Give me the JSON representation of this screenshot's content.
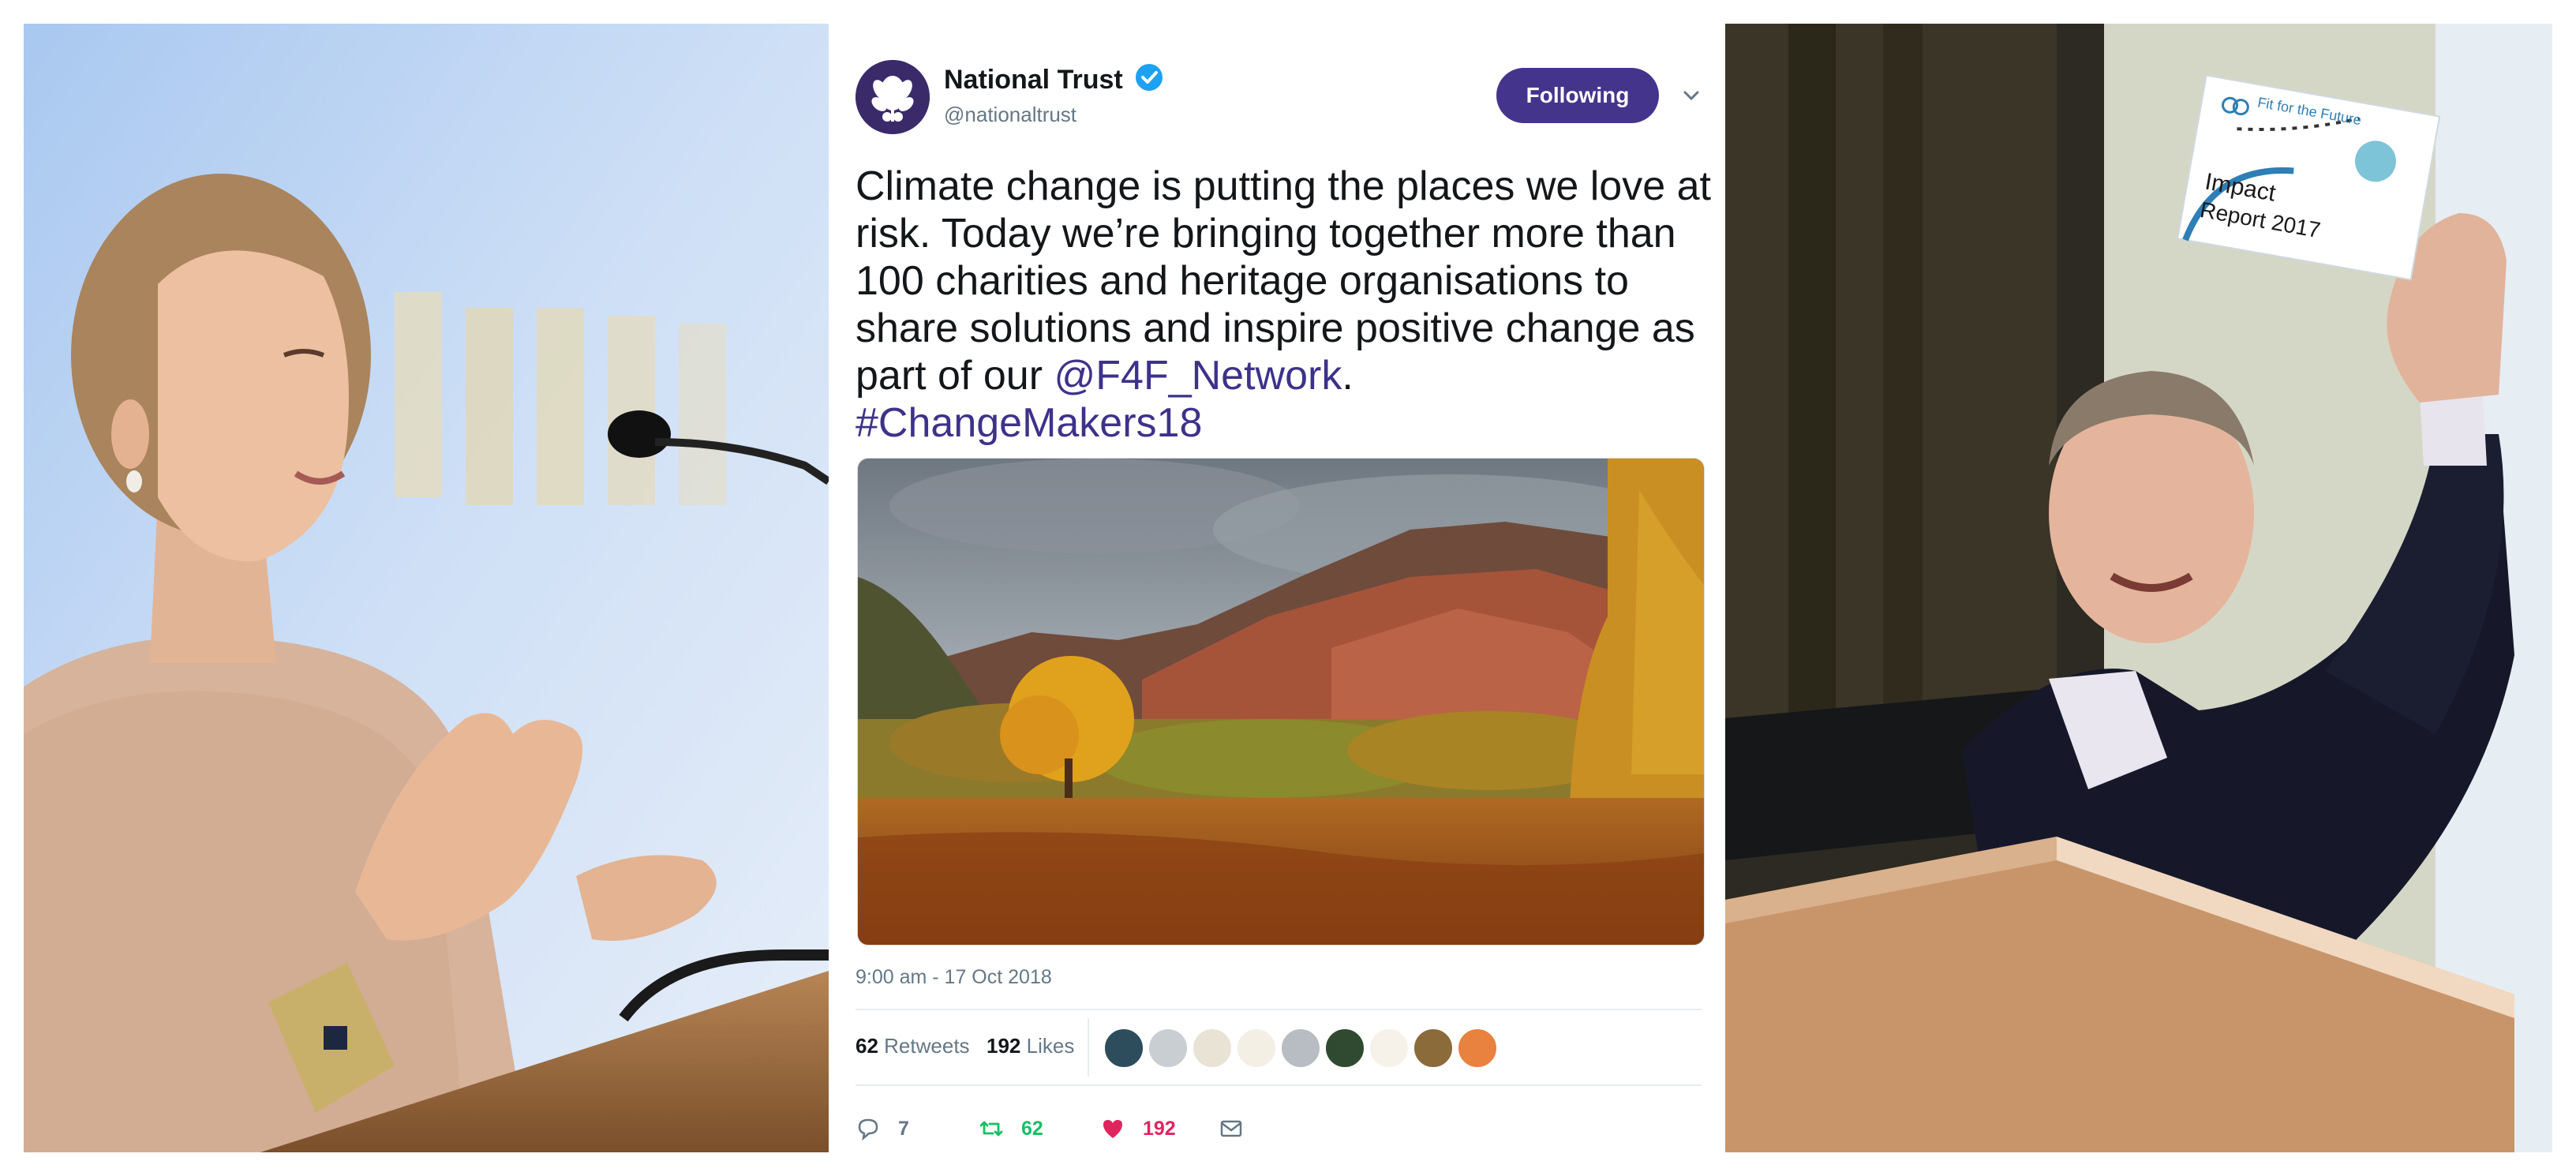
{
  "tweet": {
    "author_name": "National Trust",
    "handle": "@nationaltrust",
    "follow_label": "Following",
    "text_main": "Climate change is putting the places we love at risk. Today we’re bringing together more than 100 charities and heritage organisations to share solutions and inspire positive change as part of our ",
    "mention": "@F4F_Network",
    "text_after_mention": ".",
    "hashtag": "#ChangeMakers18",
    "timestamp": "9:00 am - 17 Oct 2018",
    "retweets_count": "62",
    "retweets_label": "Retweets",
    "likes_count": "192",
    "likes_label": "Likes",
    "reply_count": "7",
    "retweet_action_count": "62",
    "like_action_count": "192"
  },
  "photo_right": {
    "card_brand": "Fit for the Future",
    "card_title_line1": "Impact",
    "card_title_line2": "Report 2017"
  },
  "colors": {
    "follow_button": "#45348c",
    "link": "#3d328a",
    "retweet_green": "#17bf63",
    "like_pink": "#e0245e",
    "verified_blue": "#1da1f2"
  },
  "icons": [
    "national-trust-oak-leaf-logo",
    "verified-badge-icon",
    "chevron-down-icon",
    "reply-icon",
    "retweet-icon",
    "heart-icon",
    "envelope-icon"
  ]
}
